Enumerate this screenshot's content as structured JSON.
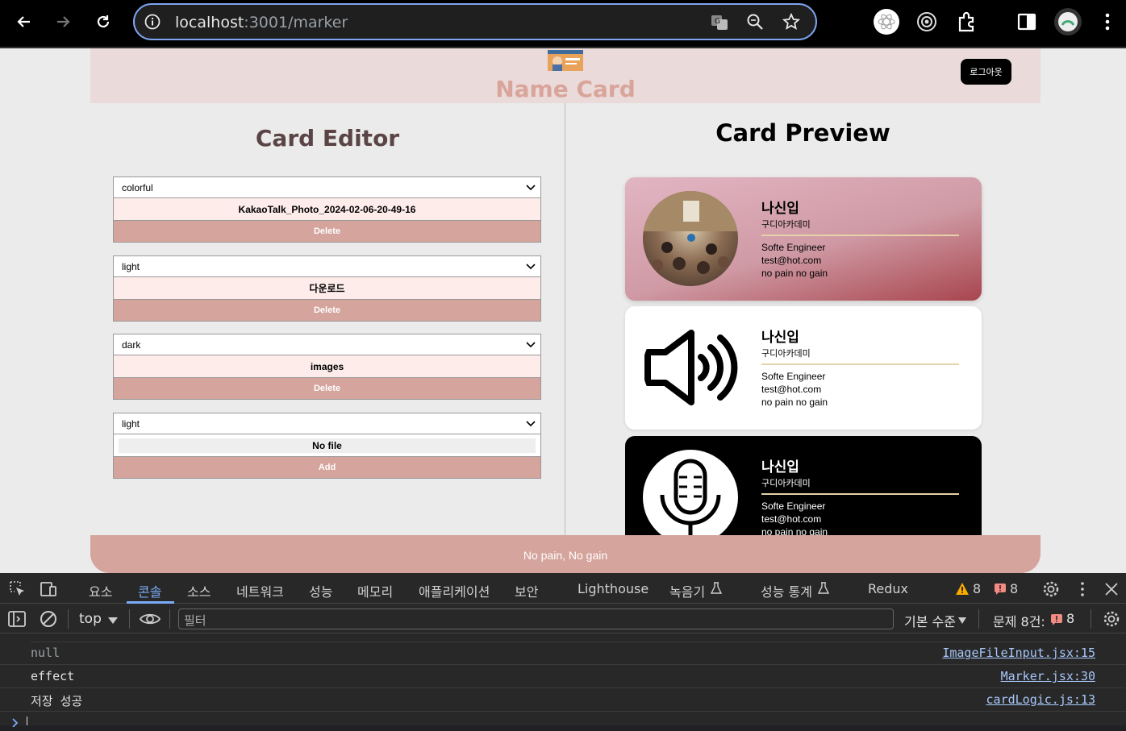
{
  "browser": {
    "url_host": "localhost",
    "url_rest": ":3001/marker"
  },
  "header": {
    "title": "Name Card",
    "logout_label": "로그아웃"
  },
  "editor": {
    "title": "Card Editor",
    "forms": [
      {
        "theme": "colorful",
        "file": "KakaoTalk_Photo_2024-02-06-20-49-16",
        "button": "Delete"
      },
      {
        "theme": "light",
        "file": "다운로드",
        "button": "Delete"
      },
      {
        "theme": "dark",
        "file": "images",
        "button": "Delete"
      },
      {
        "theme": "light",
        "file": "No file",
        "button": "Add"
      }
    ]
  },
  "preview": {
    "title": "Card Preview",
    "cards": [
      {
        "name": "나신입",
        "company": "구디아카데미",
        "title": "Softe Engineer",
        "email": "test@hot.com",
        "message": "no pain no gain",
        "theme": "colorful"
      },
      {
        "name": "나신입",
        "company": "구디아카데미",
        "title": "Softe Engineer",
        "email": "test@hot.com",
        "message": "no pain no gain",
        "theme": "light"
      },
      {
        "name": "나신입",
        "company": "구디아카데미",
        "title": "Softe Engineer",
        "email": "test@hot.com",
        "message": "no pain no gain",
        "theme": "dark"
      }
    ]
  },
  "footer": {
    "text": "No pain, No gain"
  },
  "devtools": {
    "tabs": [
      "요소",
      "콘솔",
      "소스",
      "네트워크",
      "성능",
      "메모리",
      "애플리케이션",
      "보안",
      "Lighthouse",
      "녹음기",
      "성능 통계",
      "Redux"
    ],
    "warn_count": "8",
    "issue_count": "8",
    "context": "top",
    "filter_placeholder": "필터",
    "level": "기본 수준",
    "issues_label": "문제 8건:",
    "issues_num": "8",
    "logs": [
      {
        "msg": "null",
        "src": "ImageFileInput.jsx:15"
      },
      {
        "msg": "effect",
        "src": "Marker.jsx:30"
      },
      {
        "msg": "저장 성공",
        "src": "cardLogic.js:13"
      }
    ]
  },
  "colors": {
    "accent": "#d5a49c",
    "header_bg": "#ebdada",
    "title": "#d9a499"
  }
}
